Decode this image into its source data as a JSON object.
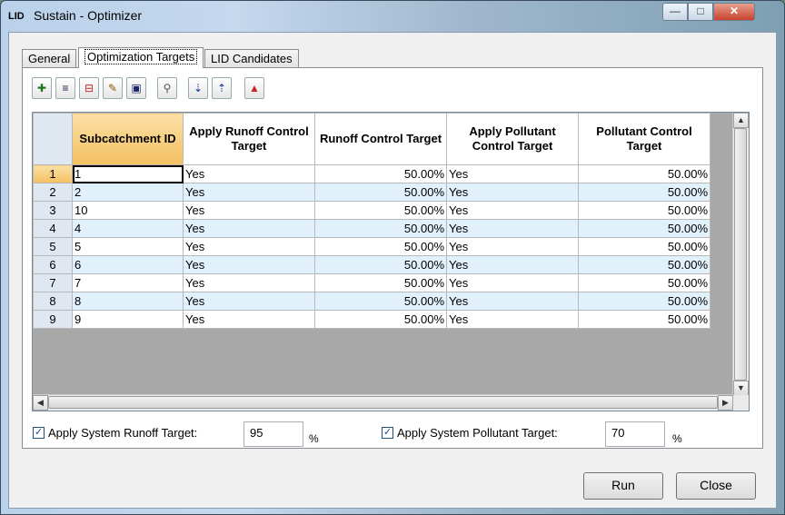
{
  "window": {
    "title": "Sustain - Optimizer",
    "app_icon_text": "LID"
  },
  "tabs": [
    {
      "label": "General"
    },
    {
      "label": "Optimization Targets"
    },
    {
      "label": "LID Candidates"
    }
  ],
  "toolbar_icons": [
    "add-row-icon",
    "help-row-icon",
    "delete-row-icon",
    "edit-row-icon",
    "save-icon",
    "search-icon",
    "sort-ascending-icon",
    "sort-descending-icon",
    "chart-icon"
  ],
  "grid": {
    "columns": [
      "Subcatchment ID",
      "Apply Runoff Control Target",
      "Runoff Control Target",
      "Apply Pollutant Control Target",
      "Pollutant Control Target"
    ],
    "rows": [
      {
        "num": "1",
        "id": "1",
        "apply_runoff": "Yes",
        "runoff": "50.00%",
        "apply_pollutant": "Yes",
        "pollutant": "50.00%"
      },
      {
        "num": "2",
        "id": "2",
        "apply_runoff": "Yes",
        "runoff": "50.00%",
        "apply_pollutant": "Yes",
        "pollutant": "50.00%"
      },
      {
        "num": "3",
        "id": "10",
        "apply_runoff": "Yes",
        "runoff": "50.00%",
        "apply_pollutant": "Yes",
        "pollutant": "50.00%"
      },
      {
        "num": "4",
        "id": "4",
        "apply_runoff": "Yes",
        "runoff": "50.00%",
        "apply_pollutant": "Yes",
        "pollutant": "50.00%"
      },
      {
        "num": "5",
        "id": "5",
        "apply_runoff": "Yes",
        "runoff": "50.00%",
        "apply_pollutant": "Yes",
        "pollutant": "50.00%"
      },
      {
        "num": "6",
        "id": "6",
        "apply_runoff": "Yes",
        "runoff": "50.00%",
        "apply_pollutant": "Yes",
        "pollutant": "50.00%"
      },
      {
        "num": "7",
        "id": "7",
        "apply_runoff": "Yes",
        "runoff": "50.00%",
        "apply_pollutant": "Yes",
        "pollutant": "50.00%"
      },
      {
        "num": "8",
        "id": "8",
        "apply_runoff": "Yes",
        "runoff": "50.00%",
        "apply_pollutant": "Yes",
        "pollutant": "50.00%"
      },
      {
        "num": "9",
        "id": "9",
        "apply_runoff": "Yes",
        "runoff": "50.00%",
        "apply_pollutant": "Yes",
        "pollutant": "50.00%"
      }
    ]
  },
  "system_runoff": {
    "label": "Apply System Runoff Target:",
    "value": "95",
    "unit": "%",
    "checked": true
  },
  "system_pollutant": {
    "label": "Apply System Pollutant Target:",
    "value": "70",
    "unit": "%",
    "checked": true
  },
  "buttons": {
    "run": "Run",
    "close": "Close"
  }
}
